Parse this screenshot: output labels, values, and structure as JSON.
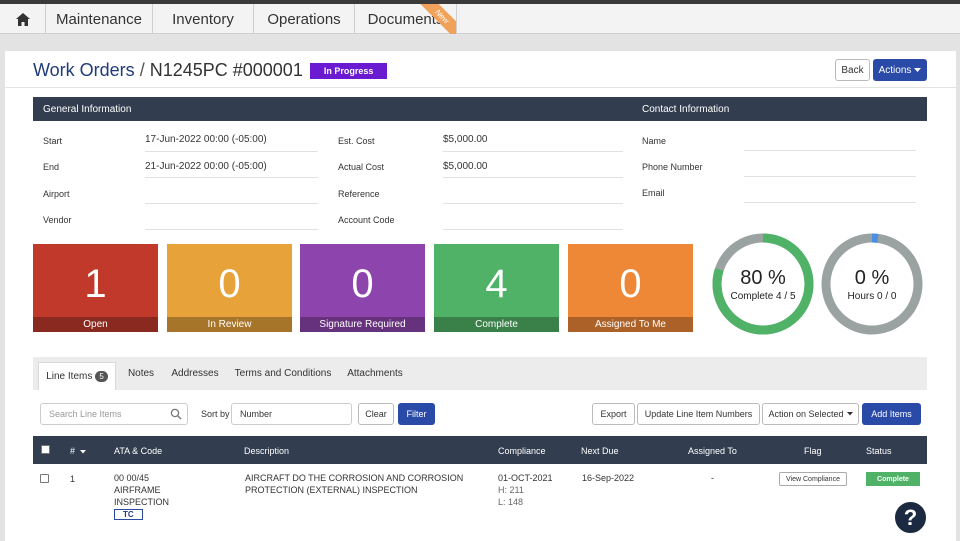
{
  "nav": {
    "home_icon": "home-icon",
    "items": [
      "Maintenance",
      "Inventory",
      "Operations",
      "Documents"
    ],
    "new_badge": "New"
  },
  "header": {
    "breadcrumb": "Work Orders",
    "separator": "/",
    "work_order": "N1245PC #000001",
    "status": "In Progress",
    "back_label": "Back",
    "actions_label": "Actions"
  },
  "info": {
    "general_title": "General Information",
    "contact_title": "Contact Information",
    "start_label": "Start",
    "start_value": "17-Jun-2022 00:00 (-05:00)",
    "end_label": "End",
    "end_value": "21-Jun-2022 00:00 (-05:00)",
    "airport_label": "Airport",
    "vendor_label": "Vendor",
    "est_cost_label": "Est. Cost",
    "est_cost_value": "$5,000.00",
    "actual_cost_label": "Actual Cost",
    "actual_cost_value": "$5,000.00",
    "reference_label": "Reference",
    "account_code_label": "Account Code",
    "name_label": "Name",
    "phone_label": "Phone Number",
    "email_label": "Email"
  },
  "tiles": [
    {
      "count": "1",
      "label": "Open",
      "color": "#c0392b"
    },
    {
      "count": "0",
      "label": "In Review",
      "color": "#e8a23a"
    },
    {
      "count": "0",
      "label": "Signature Required",
      "color": "#8e44ad"
    },
    {
      "count": "4",
      "label": "Complete",
      "color": "#4fb266"
    },
    {
      "count": "0",
      "label": "Assigned To Me",
      "color": "#ee8736"
    }
  ],
  "progress": {
    "complete_pct": "80 %",
    "complete_sub": "Complete 4 / 5",
    "complete_fraction": 0.8,
    "hours_pct": "0 %",
    "hours_sub": "Hours 0 / 0",
    "hours_fraction": 0.0
  },
  "tabs": {
    "line_items": "Line Items",
    "line_items_count": "5",
    "notes": "Notes",
    "addresses": "Addresses",
    "terms": "Terms and Conditions",
    "attachments": "Attachments"
  },
  "toolbar": {
    "search_placeholder": "Search Line Items",
    "sort_label": "Sort by",
    "sort_value": "Number",
    "clear": "Clear",
    "filter": "Filter",
    "export": "Export",
    "update": "Update Line Item Numbers",
    "action_selected": "Action on Selected",
    "add_items": "Add Items"
  },
  "table": {
    "headers": {
      "num": "#",
      "ata": "ATA & Code",
      "description": "Description",
      "compliance": "Compliance",
      "next_due": "Next Due",
      "assigned": "Assigned To",
      "flag": "Flag",
      "status": "Status"
    },
    "row": {
      "num": "1",
      "ata_line1": "00 00/45",
      "ata_line2": "AIRFRAME",
      "ata_line3": "INSPECTION",
      "tc": "TC",
      "desc_line1": "AIRCRAFT DO THE CORROSION AND CORROSION",
      "desc_line2": "PROTECTION (EXTERNAL) INSPECTION",
      "compliance_date": "01-OCT-2021",
      "compliance_h": "H: 211",
      "compliance_l": "L: 148",
      "next_due": "16-Sep-2022",
      "assigned": "-",
      "flag_button": "View Compliance",
      "status": "Complete"
    }
  },
  "help": "?"
}
